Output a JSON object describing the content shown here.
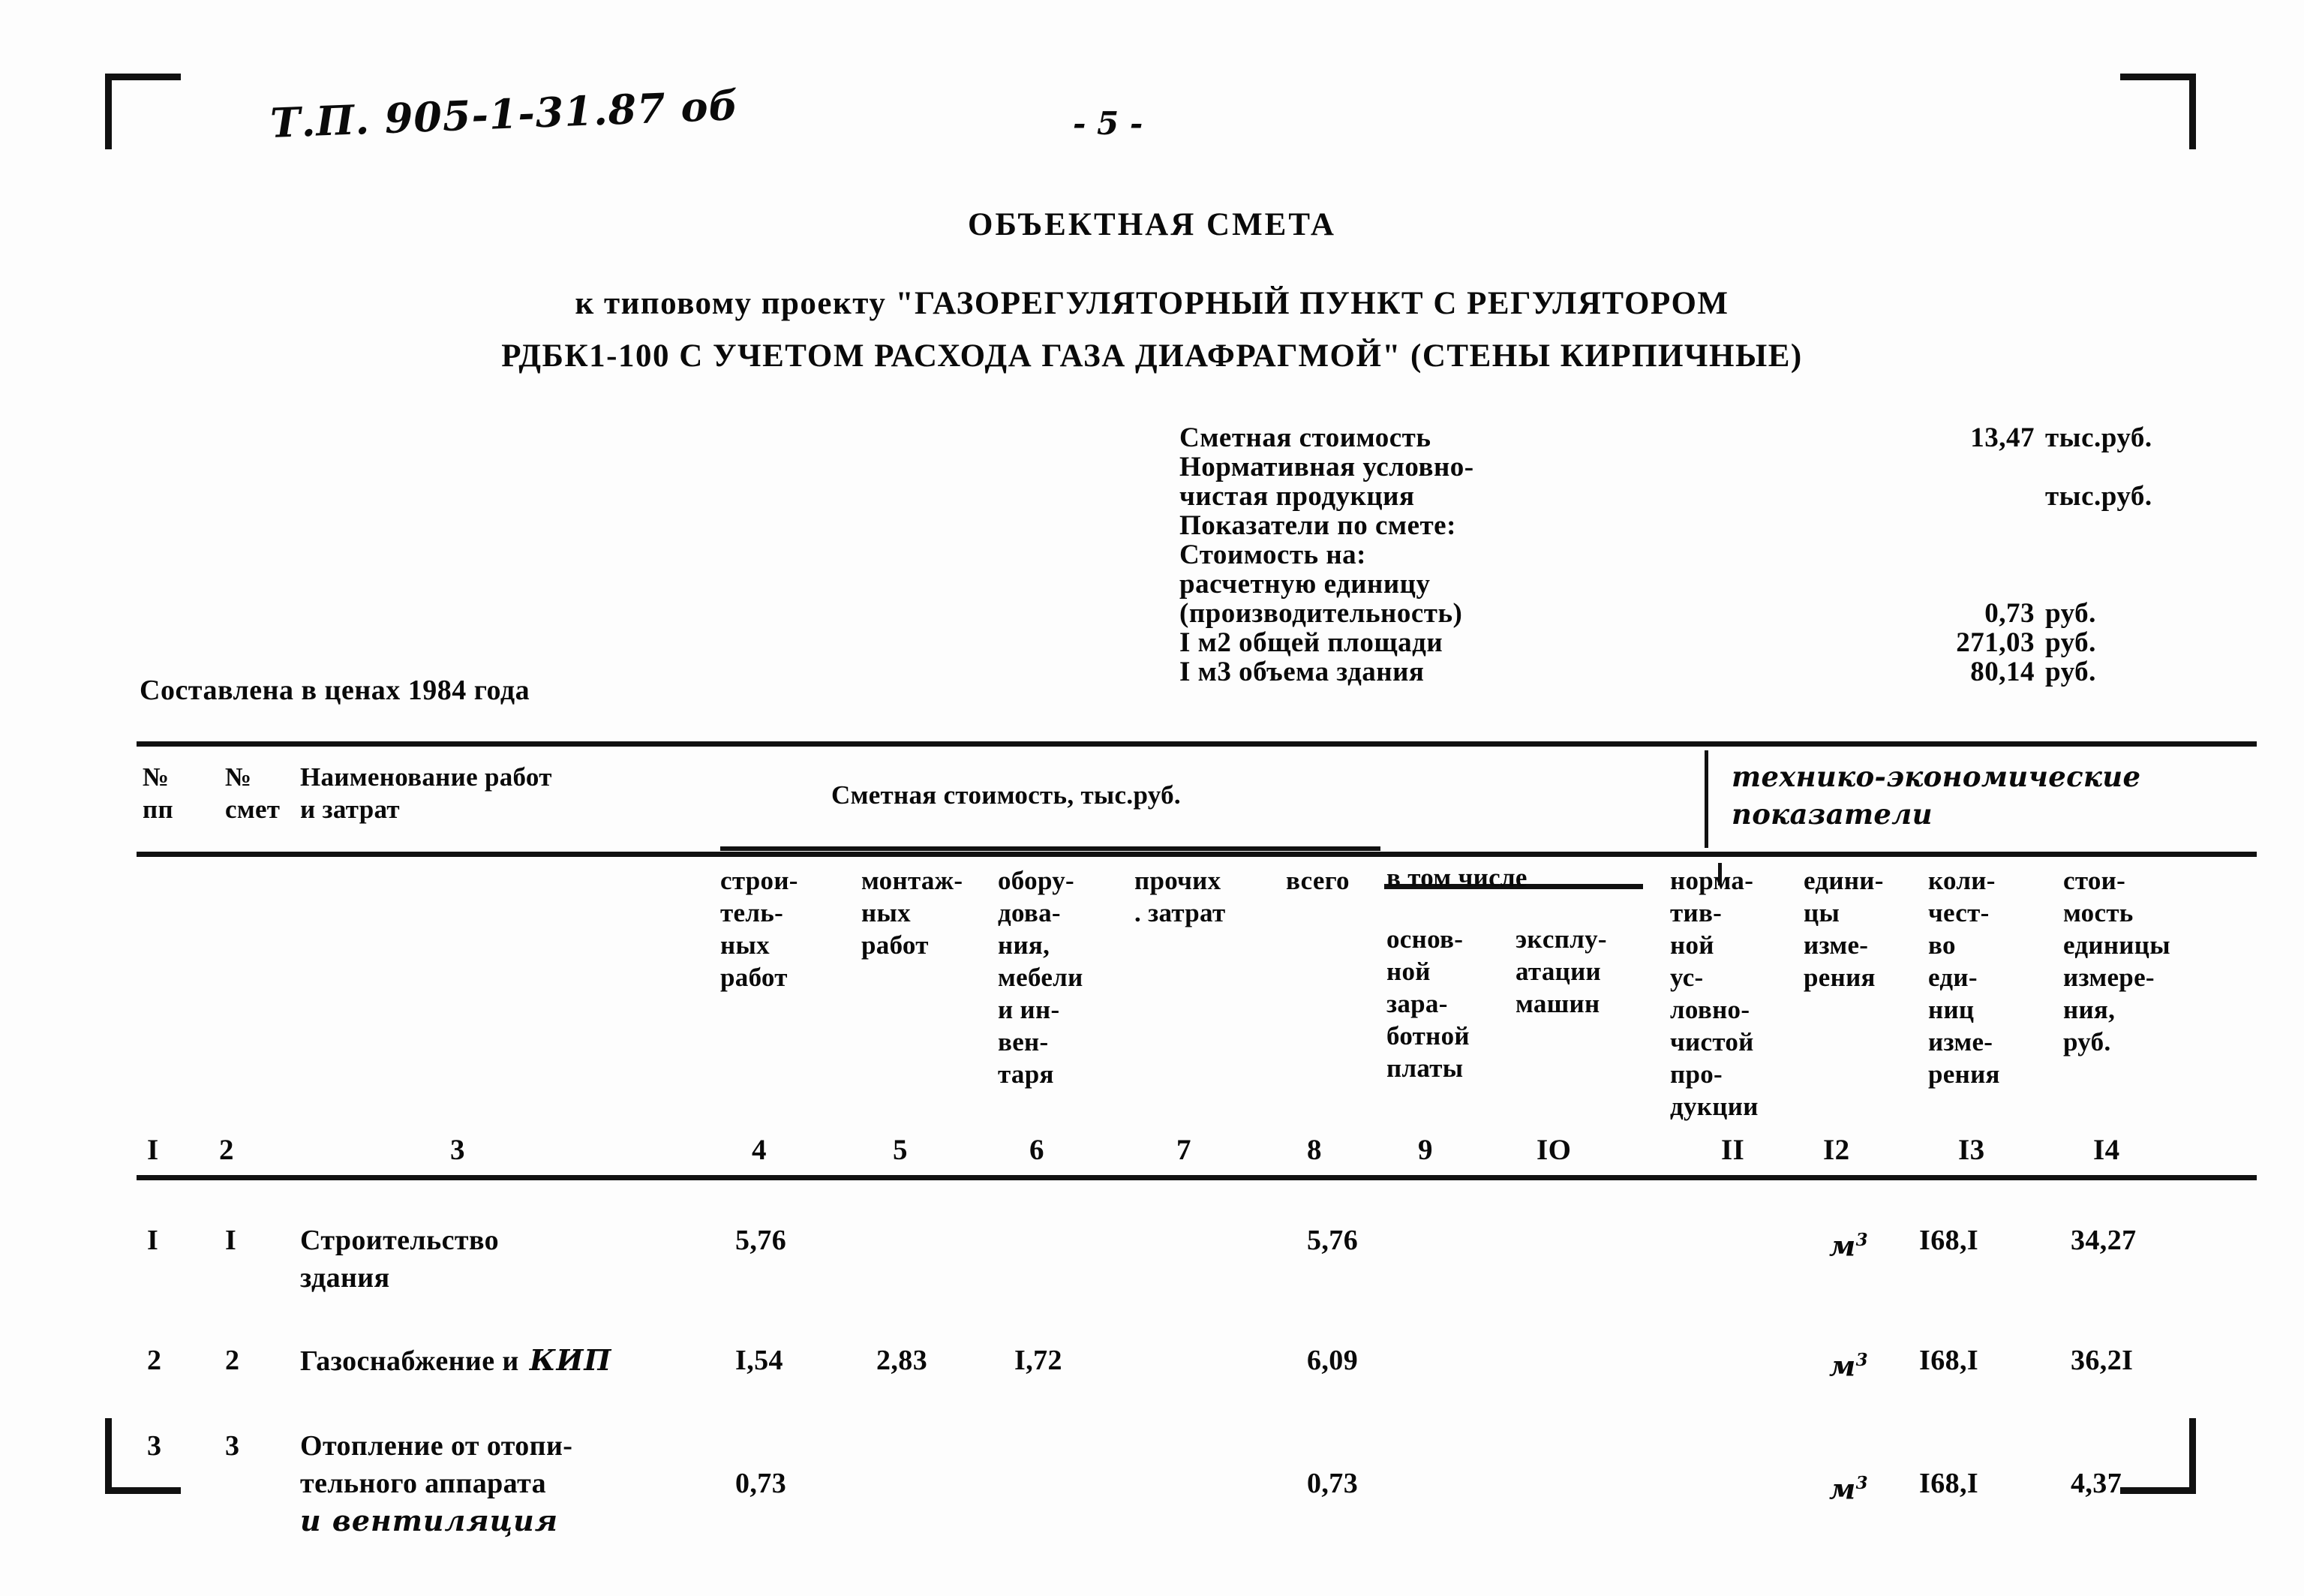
{
  "header": {
    "doc_code": "Т.П.  905-1-31.87 об",
    "page_number": "- 5 -"
  },
  "title": {
    "main": "ОБЪЕКТНАЯ СМЕТА",
    "subtitle_line1": "к типовому проекту \"ГАЗОРЕГУЛЯТОРНЫЙ ПУНКТ С РЕГУЛЯТОРОМ",
    "subtitle_line2": "РДБК1-100 С УЧЕТОМ РАСХОДА ГАЗА ДИАФРАГМОЙ\" (СТЕНЫ КИРПИЧНЫЕ)"
  },
  "summary": {
    "rows": [
      {
        "label": "Сметная стоимость",
        "value": "13,47",
        "unit": "тыс.руб."
      },
      {
        "label": "Нормативная условно-",
        "value": "",
        "unit": ""
      },
      {
        "label": "чистая продукция",
        "value": "",
        "unit": "тыс.руб."
      },
      {
        "label": "Показатели по смете:",
        "value": "",
        "unit": ""
      },
      {
        "label": "Стоимость на:",
        "value": "",
        "unit": ""
      },
      {
        "label": "расчетную единицу",
        "value": "",
        "unit": ""
      },
      {
        "label": "(производительность)",
        "value": "0,73",
        "unit": "руб."
      },
      {
        "label": "I м2 общей площади",
        "value": "271,03",
        "unit": "руб."
      },
      {
        "label": "I м3 объема здания",
        "value": "80,14",
        "unit": "руб."
      }
    ]
  },
  "prices_note": "Составлена в ценах 1984 года",
  "table": {
    "headers": {
      "npp": "№\nпп",
      "nsmet": "№\nсмет",
      "name": "Наименование работ\nи затрат",
      "smeta_group": "Сметная стоимость, тыс.руб.",
      "teh_group": "технико-экономические\nпоказатели",
      "c4": "строи-\nтель-\nных\nработ",
      "c5": "монтаж-\nных\nработ",
      "c6": "обору-\nдова-\nния,\nмебели\nи ин-\nвен-\nтаря",
      "c7": "прочих\n. затрат",
      "c8": "всего",
      "vtom": "в том числе",
      "c9": "основ-\nной\nзара-\nботной\nплаты",
      "c10": "экcплу-\nатации\nмашин",
      "c11": "норма-\nтив-\nной\nус-\nловно-\nчистой\nпро-\nдукции",
      "c12": "едини-\nцы\nизме-\nрения",
      "c13": "коли-\nчест-\nво\nеди-\nниц\nизме-\nрения",
      "c14": "стои-\nмость\nединицы\nизмере-\nния,\nруб."
    },
    "column_numbers": [
      "I",
      "2",
      "3",
      "4",
      "5",
      "6",
      "7",
      "8",
      "9",
      "IO",
      "II",
      "I2",
      "I3",
      "I4"
    ],
    "rows": [
      {
        "npp": "I",
        "nsmet": "I",
        "name": "Строительство\nздания",
        "name_hand": "",
        "c4": "5,76",
        "c5": "",
        "c6": "",
        "c7": "",
        "c8": "5,76",
        "c9": "",
        "c10": "",
        "c11": "",
        "c12": "м",
        "c12_sup": "3",
        "c13": "I68,I",
        "c14": "34,27"
      },
      {
        "npp": "2",
        "nsmet": "2",
        "name": "Газоснабжение и",
        "name_hand": "КИП",
        "c4": "I,54",
        "c5": "2,83",
        "c6": "I,72",
        "c7": "",
        "c8": "6,09",
        "c9": "",
        "c10": "",
        "c11": "",
        "c12": "м",
        "c12_sup": "3",
        "c13": "I68,I",
        "c14": "36,2I"
      },
      {
        "npp": "3",
        "nsmet": "3",
        "name": "Отопление от отопи-\nтельного аппарата",
        "name_hand": "и вентиляция",
        "c4": "0,73",
        "c5": "",
        "c6": "",
        "c7": "",
        "c8": "0,73",
        "c9": "",
        "c10": "",
        "c11": "",
        "c12": "м",
        "c12_sup": "3",
        "c13": "I68,I",
        "c14": "4,37"
      }
    ]
  }
}
